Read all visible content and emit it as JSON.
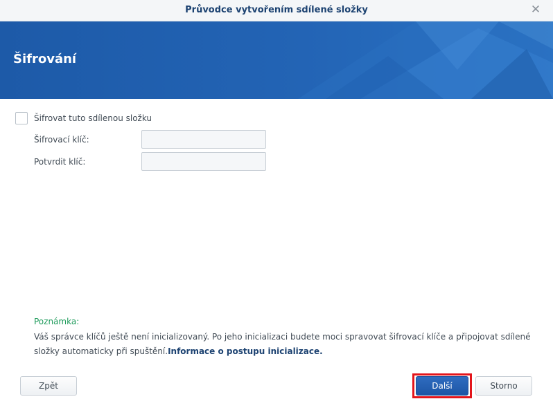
{
  "window": {
    "title": "Průvodce vytvořením sdílené složky",
    "close_symbol": "✕"
  },
  "banner": {
    "title": "Šifrování"
  },
  "form": {
    "encrypt_checkbox_label": "Šifrovat tuto sdílenou složku",
    "encrypt_checked": false,
    "key_label": "Šifrovací klíč:",
    "key_value": "",
    "confirm_label": "Potvrdit klíč:",
    "confirm_value": ""
  },
  "note": {
    "title": "Poznámka:",
    "text": "Váš správce klíčů ještě není inicializovaný. Po jeho inicializaci budete moci spravovat šifrovací klíče a připojovat sdílené složky automaticky při spuštění.",
    "link": "Informace o postupu inicializace."
  },
  "buttons": {
    "back": "Zpět",
    "next": "Další",
    "cancel": "Storno"
  },
  "colors": {
    "banner": "#2364b5",
    "primary_button": "#1d56a6",
    "note_title": "#1e9b5b",
    "highlight": "#e3151b"
  }
}
